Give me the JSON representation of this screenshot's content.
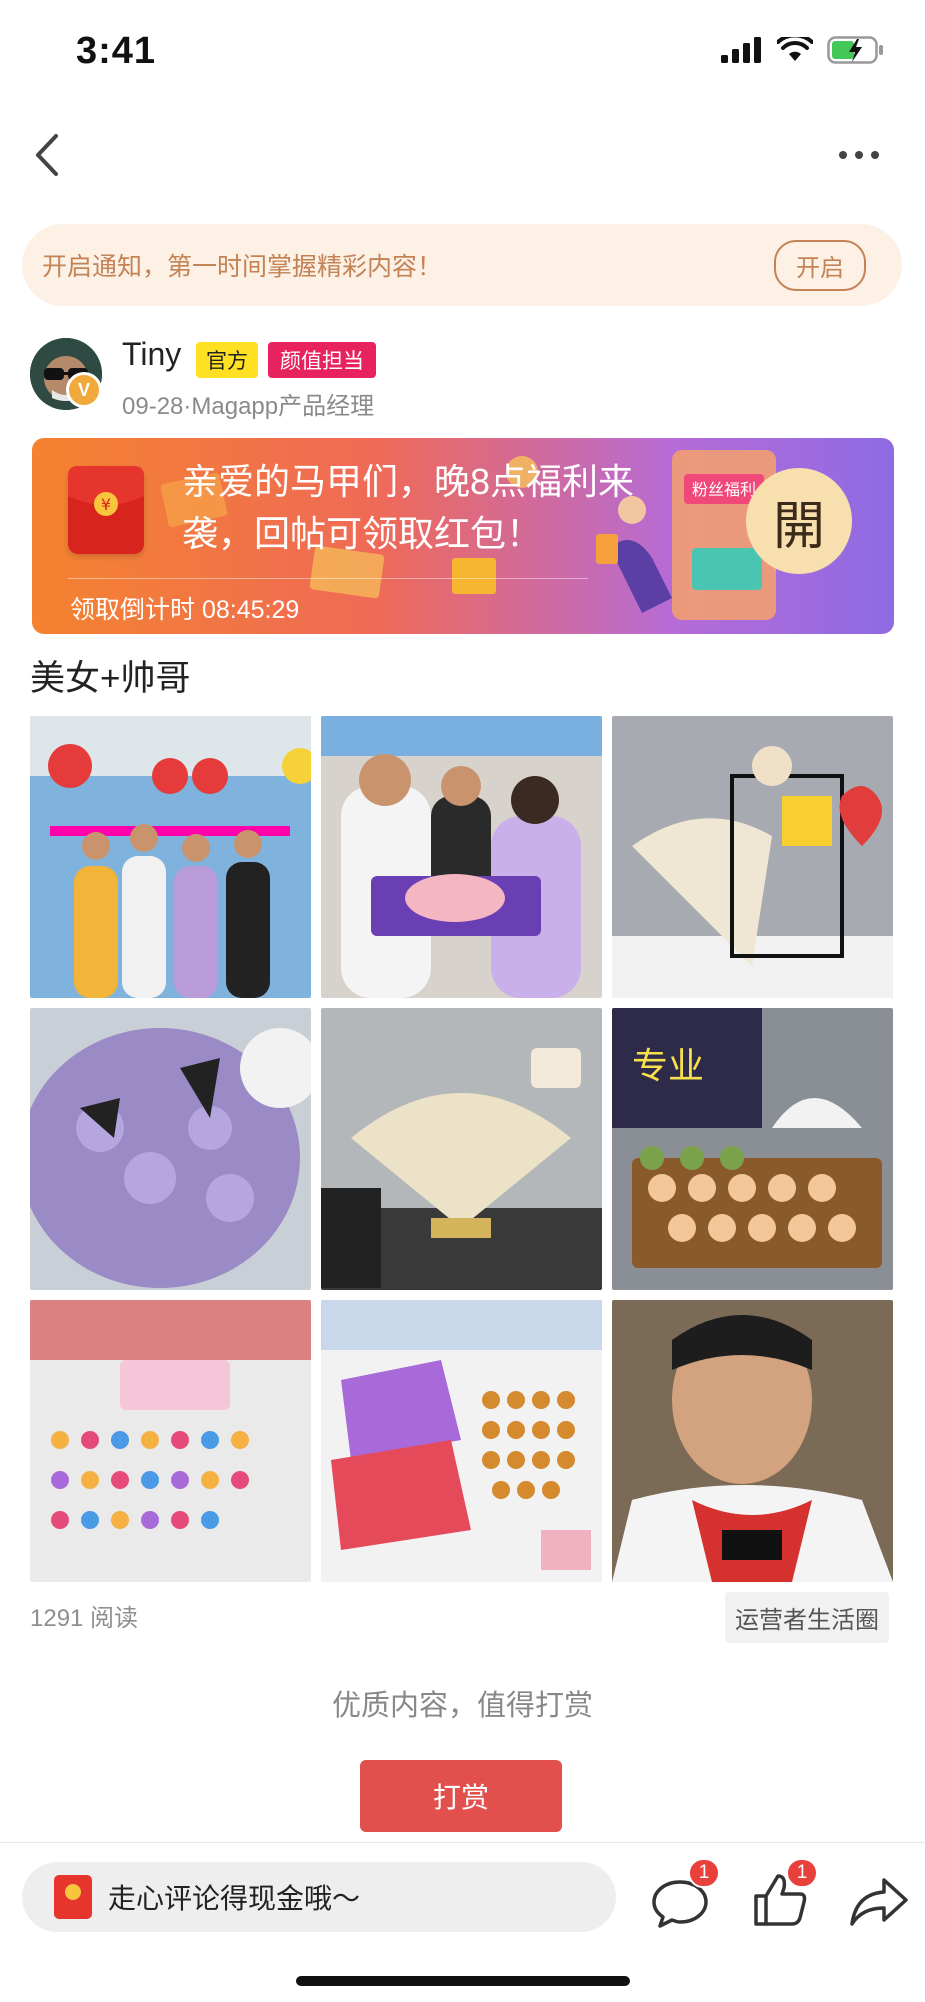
{
  "status_bar": {
    "time": "3:41"
  },
  "notify": {
    "text": "开启通知，第一时间掌握精彩内容！",
    "button": "开启"
  },
  "author": {
    "name": "Tiny",
    "tag_official": "官方",
    "tag_role": "颜值担当",
    "meta": "09-28·Magapp产品经理"
  },
  "banner": {
    "text": "亲爱的马甲们，晚8点福利来袭，回帖可领取红包！",
    "countdown": "领取倒计时 08:45:29",
    "open_button": "開",
    "sign_text": "粉丝福利"
  },
  "post": {
    "title": "美女+帅哥",
    "photos": [
      "birthday-group-photo",
      "cake-cutting-photo",
      "fan-decoration-photo",
      "taro-cake-photo",
      "folding-fan-photo",
      "cake-rolls-photo",
      "cupcakes-photo",
      "snacks-table-photo",
      "smiling-man-photo"
    ],
    "read_count": "1291 阅读",
    "circle": "运营者生活圈"
  },
  "reward": {
    "hint": "优质内容，值得打赏",
    "button": "打赏"
  },
  "bottom_bar": {
    "comment_placeholder": "走心评论得现金哦～",
    "comment_count": "1",
    "like_count": "1"
  },
  "colors": {
    "accent": "#e2504e",
    "notify_text": "#c48355",
    "badge": "#e8413b"
  }
}
